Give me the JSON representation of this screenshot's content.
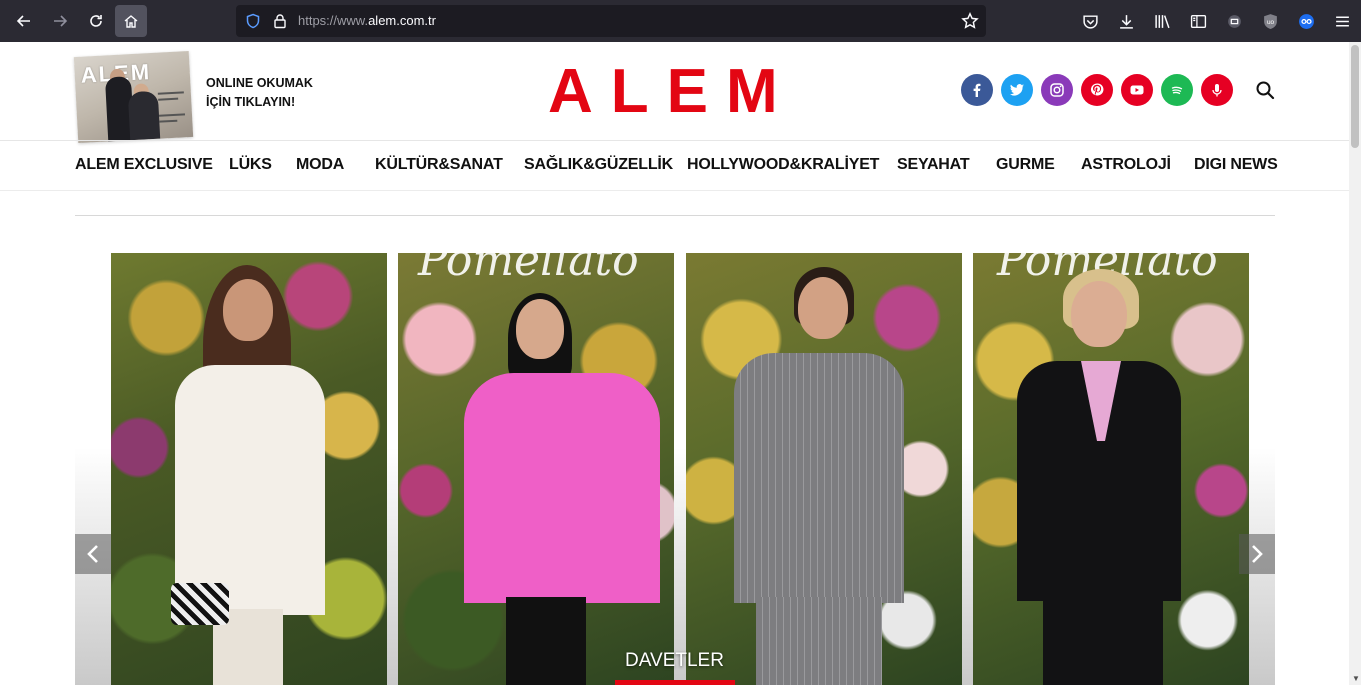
{
  "browser": {
    "url_prefix": "https://www.",
    "url_domain": "alem.com.tr",
    "icons": [
      "back-icon",
      "forward-icon",
      "reload-icon",
      "home-icon",
      "shield-icon",
      "lock-icon",
      "star-icon",
      "pocket-icon",
      "download-icon",
      "library-icon",
      "reader-icon",
      "extension-icon",
      "ublock-icon",
      "mask-icon",
      "menu-icon"
    ]
  },
  "header": {
    "magazine_cover_logo": "ALEM",
    "online_line1": "ONLINE OKUMAK",
    "online_line2": "İÇİN TIKLAYIN!",
    "logo": "ALEM",
    "social": [
      {
        "name": "facebook-icon",
        "color": "#3b5998"
      },
      {
        "name": "twitter-icon",
        "color": "#1da1f2"
      },
      {
        "name": "instagram-icon",
        "color": "#8a3ab9"
      },
      {
        "name": "pinterest-icon",
        "color": "#e60023"
      },
      {
        "name": "youtube-icon",
        "color": "#e60023"
      },
      {
        "name": "spotify-icon",
        "color": "#1db954"
      },
      {
        "name": "podcast-icon",
        "color": "#e60023"
      }
    ]
  },
  "menu": [
    "ALEM EXCLUSIVE",
    "LÜKS",
    "MODA",
    "KÜLTÜR&SANAT",
    "SAĞLIK&GÜZELLİK",
    "HOLLYWOOD&KRALİYET",
    "SEYAHAT",
    "GURME",
    "ASTROLOJİ",
    "DIGI NEWS"
  ],
  "slider": {
    "caption": "DAVETLER",
    "accent": "#e30613"
  }
}
